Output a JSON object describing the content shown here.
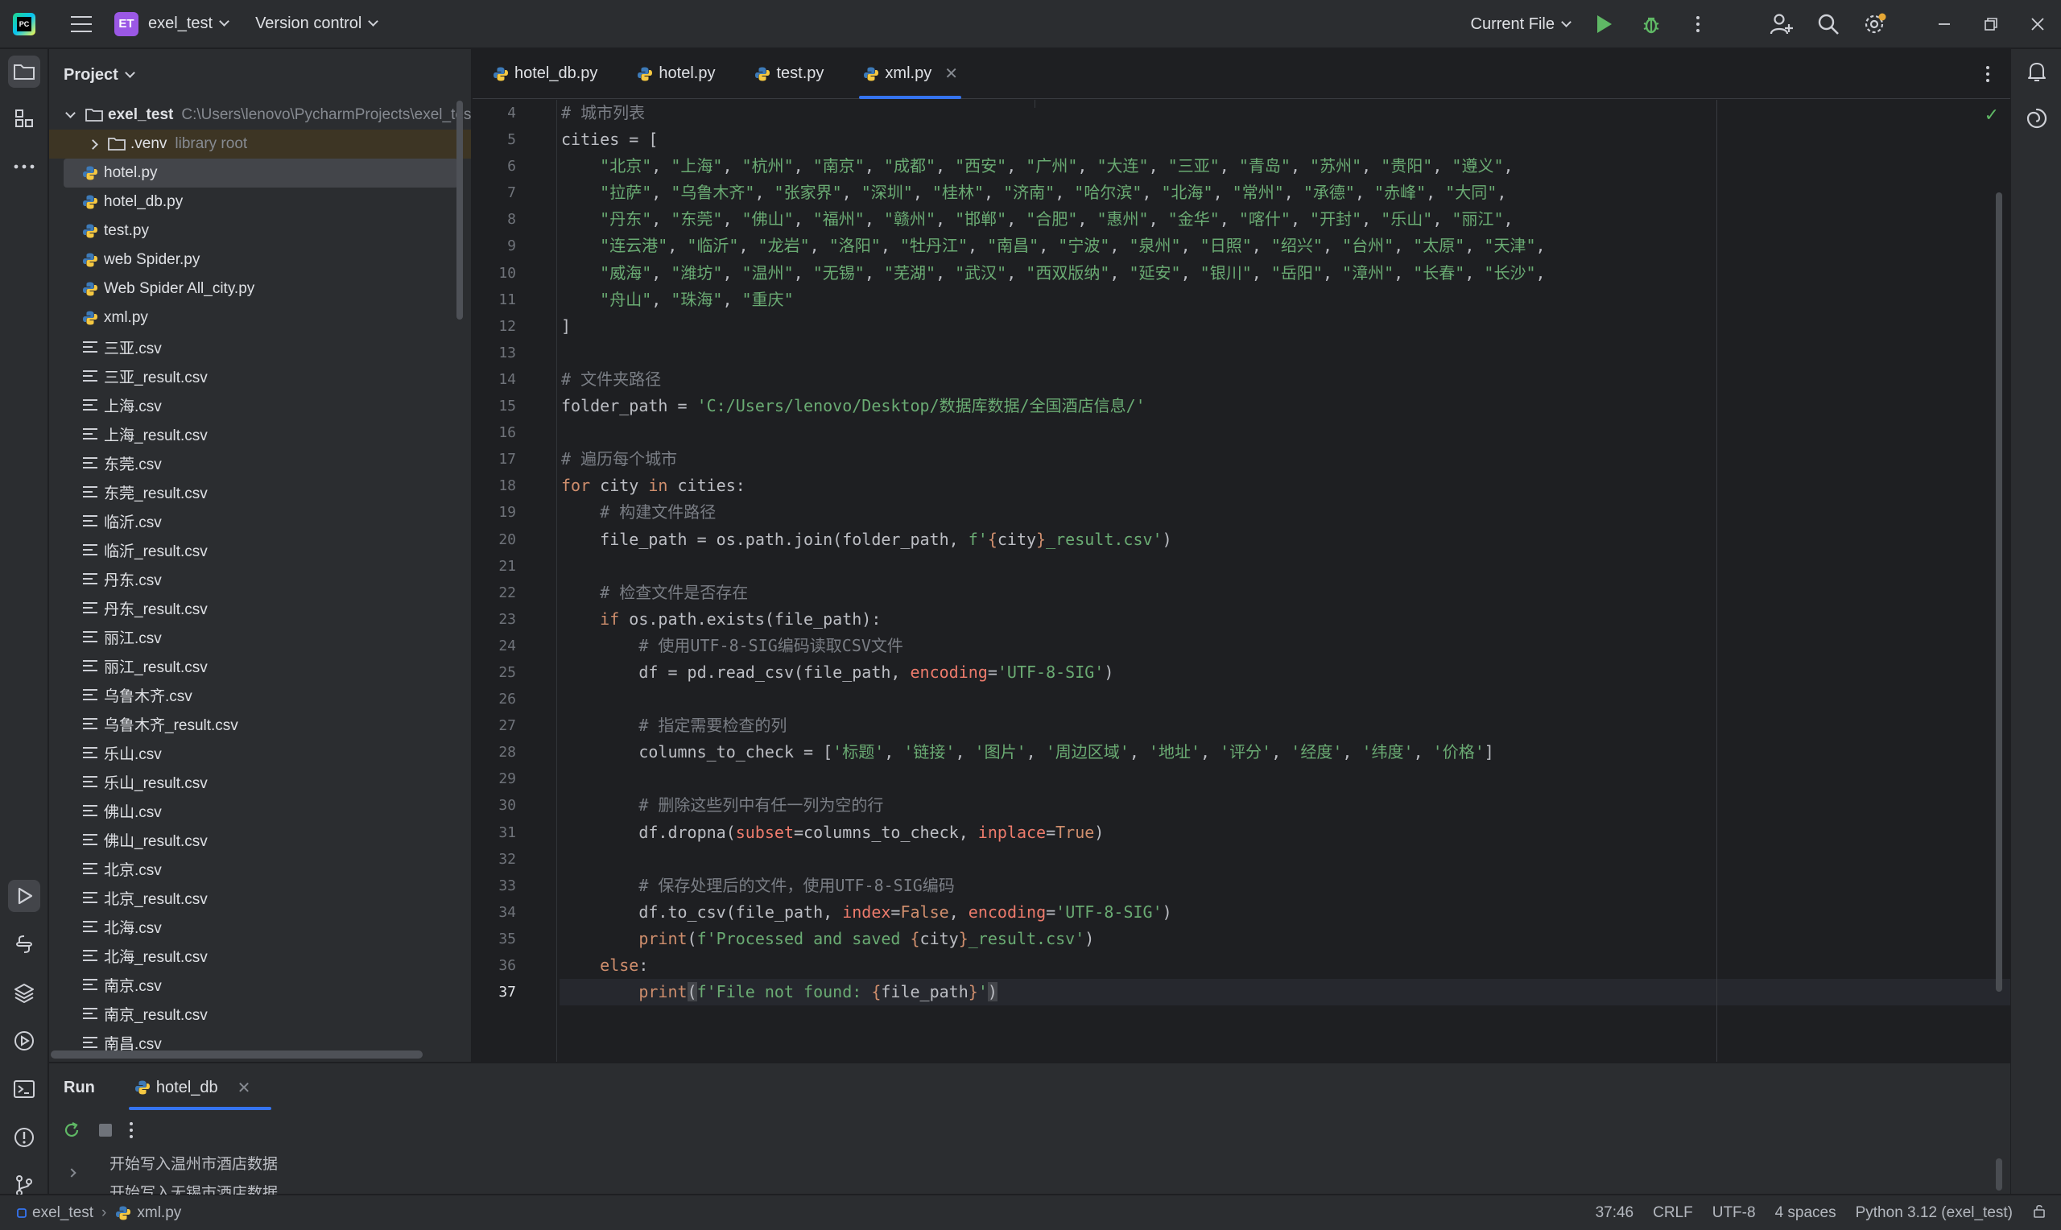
{
  "titlebar": {
    "project_badge": "ET",
    "project_name": "exel_test",
    "vcs_label": "Version control",
    "run_config": "Current File"
  },
  "project_panel": {
    "title": "Project",
    "root_name": "exel_test",
    "root_path": "C:\\Users\\lenovo\\PycharmProjects\\exel_test",
    "venv_name": ".venv",
    "venv_tag": "library root",
    "py_files": [
      "hotel.py",
      "hotel_db.py",
      "test.py",
      "web Spider.py",
      "Web Spider All_city.py",
      "xml.py"
    ],
    "csv_files": [
      "三亚.csv",
      "三亚_result.csv",
      "上海.csv",
      "上海_result.csv",
      "东莞.csv",
      "东莞_result.csv",
      "临沂.csv",
      "临沂_result.csv",
      "丹东.csv",
      "丹东_result.csv",
      "丽江.csv",
      "丽江_result.csv",
      "乌鲁木齐.csv",
      "乌鲁木齐_result.csv",
      "乐山.csv",
      "乐山_result.csv",
      "佛山.csv",
      "佛山_result.csv",
      "北京.csv",
      "北京_result.csv",
      "北海.csv",
      "北海_result.csv",
      "南京.csv",
      "南京_result.csv",
      "南昌.csv"
    ]
  },
  "editor": {
    "tabs": [
      "hotel_db.py",
      "hotel.py",
      "test.py",
      "xml.py"
    ],
    "active_tab": "xml.py",
    "line_numbers": [
      "4",
      "5",
      "6",
      "7",
      "8",
      "9",
      "10",
      "11",
      "12",
      "13",
      "14",
      "15",
      "16",
      "17",
      "18",
      "19",
      "20",
      "21",
      "22",
      "23",
      "24",
      "25",
      "26",
      "27",
      "28",
      "29",
      "30",
      "31",
      "32",
      "33",
      "34",
      "35",
      "36",
      "37"
    ],
    "current_line": "37"
  },
  "run_panel": {
    "title": "Run",
    "tab": "hotel_db",
    "output": [
      "开始写入温州市酒店数据",
      "开始写入无锡市酒店数据"
    ]
  },
  "statusbar": {
    "project": "exel_test",
    "file": "xml.py",
    "position": "37:46",
    "line_sep": "CRLF",
    "encoding": "UTF-8",
    "indent": "4 spaces",
    "interpreter": "Python 3.12 (exel_test)"
  },
  "colors": {
    "background": "#1e1f22",
    "panel": "#2b2d30",
    "accent": "#3574f0",
    "keyword": "#cf8e6d",
    "string": "#6aab73",
    "comment": "#7a7e85",
    "run_green": "#5fb865",
    "project_badge": "#9b58e5"
  },
  "icons": [
    "pycharm-logo",
    "main-menu-icon",
    "run-icon",
    "debug-icon",
    "more-icon",
    "add-user-icon",
    "search-icon",
    "settings-icon",
    "minimize-icon",
    "restore-icon",
    "close-icon",
    "folder-icon",
    "structure-icon",
    "run-tool-icon",
    "python-console-icon",
    "layers-icon",
    "services-icon",
    "terminal-icon",
    "problems-icon",
    "git-icon",
    "notifications-icon",
    "ai-assistant-icon",
    "rerun-icon",
    "stop-icon",
    "python-file-icon",
    "csv-file-icon"
  ]
}
